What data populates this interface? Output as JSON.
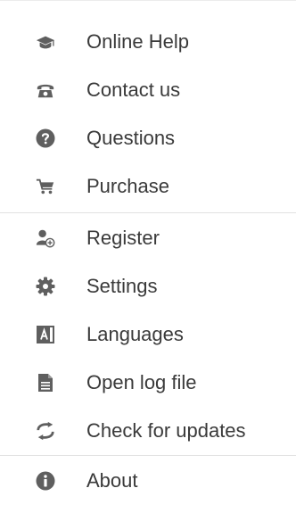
{
  "menu": {
    "items": [
      {
        "label": "Online Help",
        "icon": "graduation-cap-icon"
      },
      {
        "label": "Contact us",
        "icon": "telephone-icon"
      },
      {
        "label": "Questions",
        "icon": "question-circle-icon"
      },
      {
        "label": "Purchase",
        "icon": "shopping-cart-icon"
      },
      {
        "label": "Register",
        "icon": "user-add-icon"
      },
      {
        "label": "Settings",
        "icon": "gear-icon"
      },
      {
        "label": "Languages",
        "icon": "language-icon"
      },
      {
        "label": "Open log file",
        "icon": "document-icon"
      },
      {
        "label": "Check for updates",
        "icon": "refresh-icon"
      },
      {
        "label": "About",
        "icon": "info-circle-icon"
      }
    ]
  },
  "colors": {
    "icon": "#5f5f5f",
    "text": "#3a3a3a",
    "divider": "#e2e2e2"
  }
}
